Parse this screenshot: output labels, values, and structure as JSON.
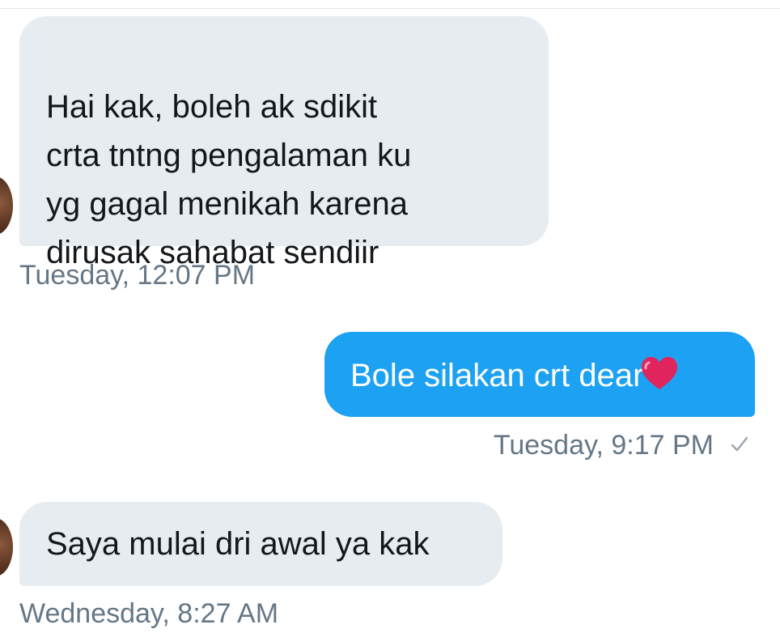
{
  "conversation": {
    "messages": [
      {
        "direction": "received",
        "text": "Hai kak, boleh ak sdikit\ncrta tntng pengalaman ku\nyg gagal menikah karena\ndirusak sahabat sendiir",
        "timestamp": "Tuesday, 12:07 PM"
      },
      {
        "direction": "sent",
        "text": "Bole silakan crt dear",
        "emoji": "heart-icon",
        "timestamp": "Tuesday, 9:17 PM",
        "status_icon": "check-icon"
      },
      {
        "direction": "received",
        "text": "Saya mulai dri awal ya kak",
        "timestamp": "Wednesday, 8:27 AM"
      }
    ]
  },
  "colors": {
    "received_bubble": "#e6ecf0",
    "sent_bubble": "#1da1f2",
    "timestamp_text": "#657786",
    "heart": "#e0245e"
  }
}
